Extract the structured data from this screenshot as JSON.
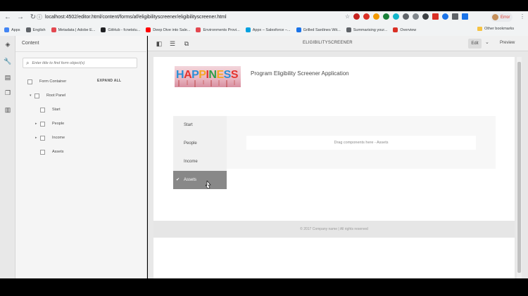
{
  "browser": {
    "url": "localhost:4502/editor.html/content/forms/af/eligibilityscreener/eligibilityscreener.html",
    "profile_label": "Error",
    "bookmarks": [
      {
        "label": "Apps",
        "color": "#4285f4"
      },
      {
        "label": "English",
        "color": "#5f6368"
      },
      {
        "label": "Metadata | Adobe E...",
        "color": "#e34850"
      },
      {
        "label": "GitHub - fcnetstu...",
        "color": "#202124"
      },
      {
        "label": "Deep Dive into Sale...",
        "color": "#ff0000"
      },
      {
        "label": "Environments Provi...",
        "color": "#e34850"
      },
      {
        "label": "Appx – Salesforce –...",
        "color": "#00a1e0"
      },
      {
        "label": "Grilled Sardines Wit...",
        "color": "#1a73e8"
      },
      {
        "label": "Summarising your...",
        "color": "#5f6368"
      },
      {
        "label": "Overview",
        "color": "#d93025"
      }
    ],
    "other_bookmarks": "Other bookmarks"
  },
  "sidebar": {
    "title": "Content",
    "search_placeholder": "Enter title to find form object(s)",
    "expand_all": "EXPAND ALL",
    "tree": [
      {
        "label": "Form Container",
        "level": 0,
        "caret": ""
      },
      {
        "label": "Root Panel",
        "level": 1,
        "caret": "▾"
      },
      {
        "label": "Start",
        "level": 2,
        "caret": ""
      },
      {
        "label": "People",
        "level": 2,
        "caret": "▸"
      },
      {
        "label": "Income",
        "level": 2,
        "caret": "▸"
      },
      {
        "label": "Assets",
        "level": 2,
        "caret": ""
      }
    ]
  },
  "toolbar": {
    "title": "ELIGIBILITYSCREENER",
    "edit_label": "Edit",
    "preview_label": "Preview"
  },
  "form": {
    "logo_text": "HAPPINESS",
    "app_title": "Program Eligibility Screener Application",
    "nav_items": [
      {
        "label": "Start",
        "active": false
      },
      {
        "label": "People",
        "active": false
      },
      {
        "label": "Income",
        "active": false
      },
      {
        "label": "Assets",
        "active": true
      }
    ],
    "check_mark": "✔",
    "dropzone_text": "Drag components here - Assets",
    "footer_text": "© 2017 Company name | All rights reserved"
  },
  "colors": {
    "active_nav": "#888888",
    "logo_letters": [
      "#2b8fd6",
      "#e3342f",
      "#2b8fd6",
      "#f6a623",
      "#e3342f",
      "#2e9e46",
      "#f6a623",
      "#2b8fd6",
      "#e3342f"
    ]
  }
}
